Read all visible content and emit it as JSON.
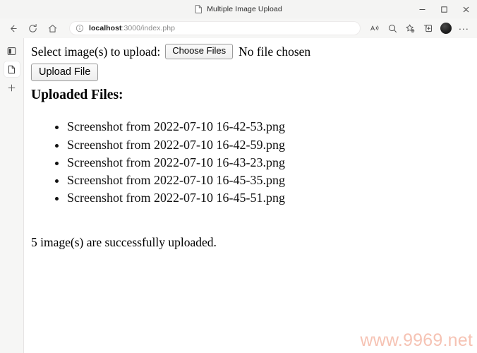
{
  "window": {
    "tab": {
      "title": "Multiple Image Upload",
      "favicon": "document-icon"
    },
    "controls": {
      "minimize": "minimize-icon",
      "maximize": "maximize-icon",
      "close": "close-icon"
    }
  },
  "toolbar": {
    "back": "back-arrow-icon",
    "refresh": "refresh-icon",
    "home": "home-icon",
    "site_info": "info-icon",
    "url_host": "localhost",
    "url_path": ":3000/index.php",
    "url_full": "localhost:3000/index.php",
    "read_aloud": "read-aloud-icon",
    "zoom_search": "search-icon",
    "favorites": "favorites-star-icon",
    "collections": "collections-icon",
    "profile": "profile-avatar",
    "settings_more": "..."
  },
  "sidebar": {
    "items": [
      {
        "name": "tab-actions-icon",
        "active": false
      },
      {
        "name": "page-icon",
        "active": true
      },
      {
        "name": "add-icon",
        "label": "+",
        "active": false
      }
    ]
  },
  "page": {
    "select_label": "Select image(s) to upload:",
    "choose_files_button": "Choose Files",
    "no_file_text": "No file chosen",
    "upload_button": "Upload File",
    "uploaded_heading": "Uploaded Files:",
    "files": [
      "Screenshot from 2022-07-10 16-42-53.png",
      "Screenshot from 2022-07-10 16-42-59.png",
      "Screenshot from 2022-07-10 16-43-23.png",
      "Screenshot from 2022-07-10 16-45-35.png",
      "Screenshot from 2022-07-10 16-45-51.png"
    ],
    "status_message": "5 image(s) are successfully uploaded.",
    "watermark": "www.9969.net"
  },
  "colors": {
    "chrome_bg": "#f6f6f5",
    "page_bg": "#ffffff",
    "watermark": "#f6c3b4",
    "text": "#000000"
  }
}
